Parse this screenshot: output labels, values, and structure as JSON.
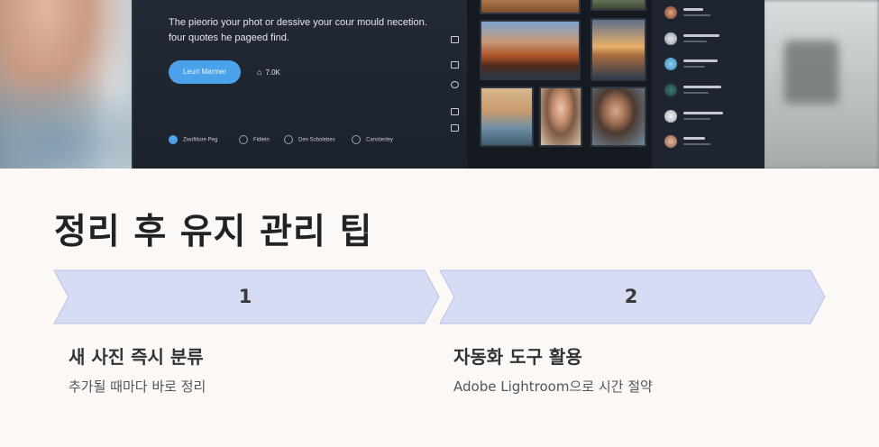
{
  "hero": {
    "headline": "The pieorio your phot or dessive your cour mould necetion. four quotes he pageed find.",
    "button_label": "Leurt Marmer",
    "stat_label": "7.0K",
    "bottom_items": [
      "Zwofiltore Peg",
      "Fidiein",
      "Den Scbolebes",
      "Canstierley"
    ],
    "accent_color": "#4aa3ea"
  },
  "section": {
    "title": "정리 후 유지 관리 팁"
  },
  "steps": [
    {
      "number": "1",
      "title": "새 사진 즉시 분류",
      "description": "추가될 때마다 바로 정리"
    },
    {
      "number": "2",
      "title": "자동화 도구 활용",
      "description": "Adobe Lightroom으로 시간 절약"
    }
  ],
  "colors": {
    "chevron_fill": "#d5dcf4",
    "chevron_stroke": "#b9c3e6",
    "background": "#fcf8f6"
  }
}
